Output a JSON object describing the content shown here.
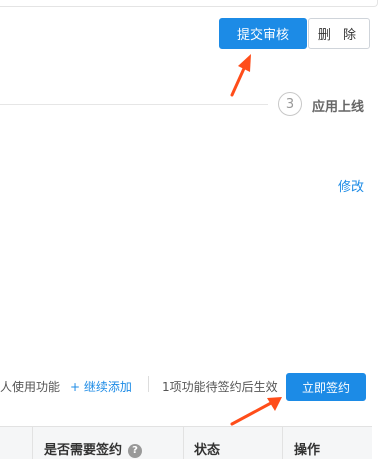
{
  "toolbar": {
    "submit_label": "提交审核",
    "delete_label": "删 除"
  },
  "steps": {
    "step3_number": "3",
    "step3_label": "应用上线"
  },
  "section": {
    "edit_label": "修改"
  },
  "functions": {
    "usage_text": "人使用功能",
    "add_label": "+ 继续添加",
    "pending_text": "1项功能待签约后生效",
    "sign_button": "立即签约"
  },
  "table": {
    "headers": [
      "是否需要签约",
      "状态",
      "操作"
    ],
    "help_icon": "?"
  },
  "colors": {
    "primary": "#1c8be6",
    "annotation_arrow": "#ff4d1a"
  }
}
